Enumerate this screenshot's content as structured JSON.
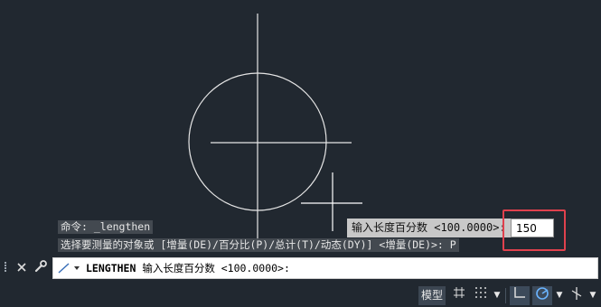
{
  "history": {
    "line1": "命令: _lengthen",
    "line2": "选择要测量的对象或 [增量(DE)/百分比(P)/总计(T)/动态(DY)] <增量(DE)>: P"
  },
  "dynamic_input": {
    "prompt": "输入长度百分数 <100.0000>:",
    "value": "150"
  },
  "command_line": {
    "command": "LENGTHEN",
    "prompt": " 输入长度百分数 <100.0000>:"
  },
  "status_bar": {
    "model_label": "模型"
  },
  "colors": {
    "background": "#212830",
    "geometry": "#e6e6e6",
    "highlight": "#e0414d"
  },
  "icons": {
    "close": "close-icon",
    "customize": "wrench-icon",
    "command": "lengthen-command-icon",
    "grid": "grid-icon",
    "snap": "snap-icon",
    "ortho": "ortho-icon",
    "polar": "polar-tracking-icon",
    "isodraft": "isodraft-icon"
  }
}
